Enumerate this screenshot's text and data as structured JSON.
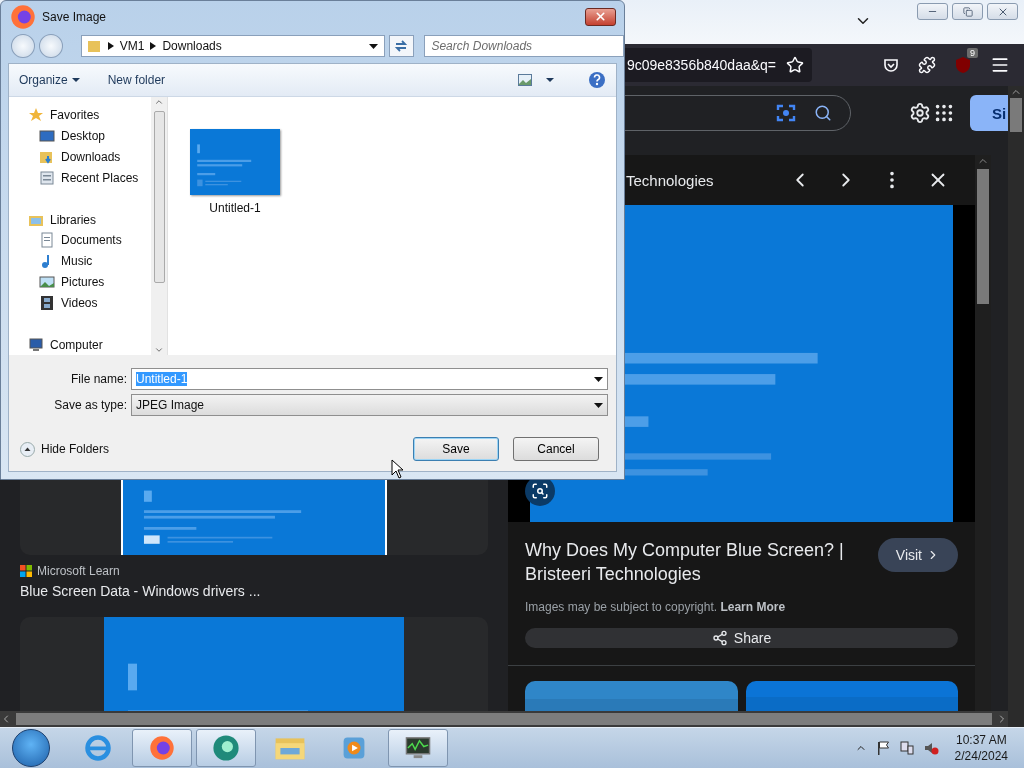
{
  "browser": {
    "url": "9c09e8356b840daa&q=",
    "extension_badge": "9",
    "sign_in": "Si"
  },
  "results": [
    {
      "source": "Microsoft Learn",
      "title": "Blue Screen Data - Windows drivers ..."
    }
  ],
  "preview": {
    "header": "Technologies",
    "title": "Why Does My Computer Blue Screen? | Bristeeri Technologies",
    "visit": "Visit",
    "notice": "Images may be subject to copyright.",
    "notice_link": "Learn More",
    "share": "Share"
  },
  "dialog": {
    "title": "Save Image",
    "path": [
      "VM1",
      "Downloads"
    ],
    "search_placeholder": "Search Downloads",
    "toolbar": [
      "Organize",
      "New folder"
    ],
    "nav": [
      {
        "label": "Favorites",
        "children": [
          {
            "label": "Desktop"
          },
          {
            "label": "Downloads"
          },
          {
            "label": "Recent Places"
          }
        ]
      },
      {
        "label": "Libraries",
        "children": [
          {
            "label": "Documents"
          },
          {
            "label": "Music"
          },
          {
            "label": "Pictures"
          },
          {
            "label": "Videos"
          }
        ]
      },
      {
        "label": "Computer"
      }
    ],
    "files": [
      {
        "name": "Untitled-1"
      }
    ],
    "file_name_label": "File name:",
    "file_name": "Untitled-1",
    "file_name_selected": true,
    "type_label": "Save as type:",
    "type": "JPEG Image",
    "hide_folders": "Hide Folders",
    "buttons": [
      {
        "label": "Save",
        "default": true
      },
      {
        "label": "Cancel",
        "default": false
      }
    ]
  },
  "taskbar": {
    "apps": [
      {
        "active": false
      },
      {
        "active": true
      },
      {
        "active": true
      },
      {
        "active": false
      },
      {
        "active": false
      },
      {
        "active": true
      }
    ],
    "time": "10:37 AM",
    "date": "2/24/2024"
  }
}
